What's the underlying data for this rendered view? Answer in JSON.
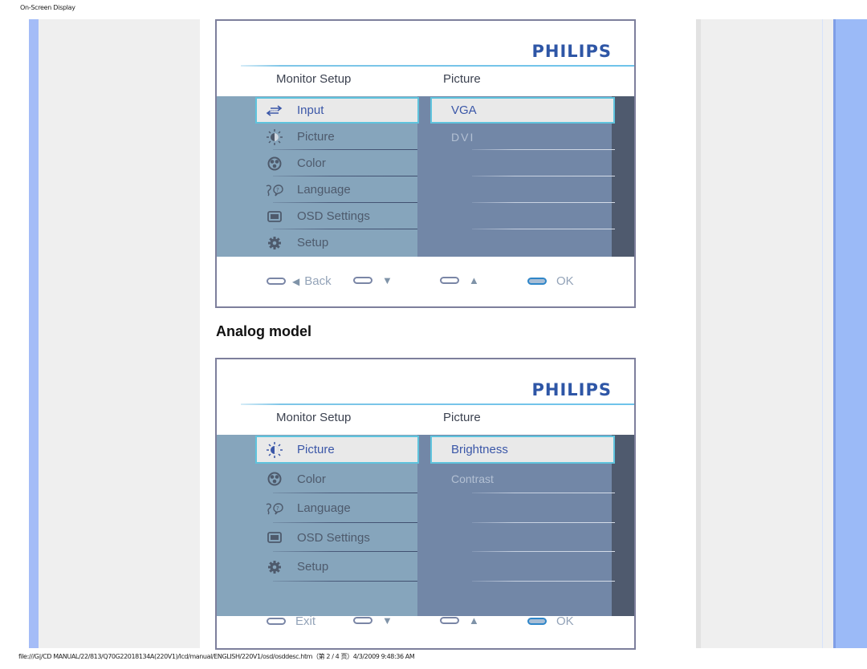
{
  "page": {
    "header": "On-Screen Display",
    "footer": "file:///G|/CD MANUAL/22/813/Q70G22018134A(220V1)/lcd/manual/ENGLISH/220V1/osd/osddesc.htm（第 2 / 4 页）4/3/2009 9:48:36 AM",
    "section_title": "Analog model"
  },
  "osd_digital": {
    "brand": "PHILIPS",
    "col_left": "Monitor Setup",
    "col_right": "Picture",
    "menu": [
      {
        "label": "Input",
        "icon": "input-arrows-icon"
      },
      {
        "label": "Picture",
        "icon": "brightness-sun-icon"
      },
      {
        "label": "Color",
        "icon": "color-palette-icon"
      },
      {
        "label": "Language",
        "icon": "language-speech-icon"
      },
      {
        "label": "OSD Settings",
        "icon": "monitor-screen-icon"
      },
      {
        "label": "Setup",
        "icon": "gear-icon"
      }
    ],
    "submenu": [
      "VGA",
      "DVI"
    ],
    "footer": [
      {
        "label": "Back",
        "arrow": "◀"
      },
      {
        "label": "",
        "arrow": "▼"
      },
      {
        "label": "",
        "arrow": "▲"
      },
      {
        "label": "OK",
        "arrow": ""
      }
    ]
  },
  "osd_analog": {
    "brand": "PHILIPS",
    "col_left": "Monitor Setup",
    "col_right": "Picture",
    "menu": [
      {
        "label": "Picture",
        "icon": "brightness-sun-icon"
      },
      {
        "label": "Color",
        "icon": "color-palette-icon"
      },
      {
        "label": "Language",
        "icon": "language-speech-icon"
      },
      {
        "label": "OSD Settings",
        "icon": "monitor-screen-icon"
      },
      {
        "label": "Setup",
        "icon": "gear-icon"
      }
    ],
    "submenu": [
      "Brightness",
      "Contrast"
    ],
    "footer": [
      {
        "label": "Exit",
        "arrow": ""
      },
      {
        "label": "",
        "arrow": "▼"
      },
      {
        "label": "",
        "arrow": "▲"
      },
      {
        "label": "OK",
        "arrow": ""
      }
    ]
  },
  "colors": {
    "brand_blue": "#2e56a6",
    "highlight_border": "#5fc3dd",
    "menu_left_bg": "#86a5bc",
    "menu_right_bg": "#7287a7"
  }
}
